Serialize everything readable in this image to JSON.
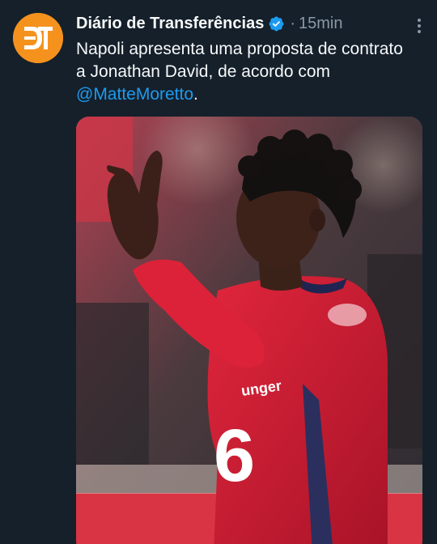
{
  "tweet": {
    "author_name": "Diário de Transferências",
    "verified_icon": "verified-badge-icon",
    "separator": "·",
    "timestamp": "15min",
    "avatar_monogram": "DT",
    "text_part1": "Napoli apresenta uma proposta de contrato a Jonathan David, de acordo com ",
    "mention": "@MatteMoretto",
    "text_part2": ".",
    "more_icon": "more-vertical-icon",
    "media": {
      "jersey_sponsor_fragment": "unger",
      "jersey_number_fragment": "6"
    }
  },
  "colors": {
    "background": "#15202b",
    "text": "#f7f9f9",
    "secondary_text": "#8b98a5",
    "link": "#1d9bf0",
    "avatar_bg": "#f5921e",
    "jersey_red": "#c8182e"
  }
}
